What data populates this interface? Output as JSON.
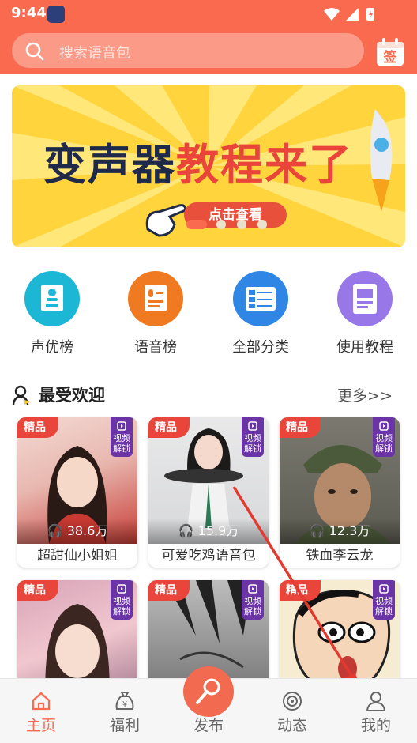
{
  "status": {
    "time": "9:44"
  },
  "search": {
    "placeholder": "搜索语音包"
  },
  "signin": {
    "label": "签"
  },
  "banner": {
    "title_part1": "变声器",
    "title_part2": "教程来了",
    "cta": "点击查看",
    "slide_current": 1,
    "slide_total": 4
  },
  "categories": [
    {
      "label": "声优榜",
      "icon": "voice-actor-icon",
      "color": "#1bb7d4"
    },
    {
      "label": "语音榜",
      "icon": "voice-list-icon",
      "color": "#f07a22"
    },
    {
      "label": "全部分类",
      "icon": "category-list-icon",
      "color": "#2f86e4"
    },
    {
      "label": "使用教程",
      "icon": "book-icon",
      "color": "#9877e8"
    }
  ],
  "section": {
    "title": "最受欢迎",
    "more": "更多>>"
  },
  "cards": [
    {
      "badge": "精品",
      "lock": "视频解锁",
      "plays": "38.6万",
      "name": "超甜仙小姐姐"
    },
    {
      "badge": "精品",
      "lock": "视频解锁",
      "plays": "15.9万",
      "name": "可爱吃鸡语音包"
    },
    {
      "badge": "精品",
      "lock": "视频解锁",
      "plays": "12.3万",
      "name": "铁血李云龙"
    },
    {
      "badge": "精品",
      "lock": "视频解锁",
      "plays": "",
      "name": ""
    },
    {
      "badge": "精品",
      "lock": "视频解锁",
      "plays": "",
      "name": ""
    },
    {
      "badge": "精品",
      "lock": "视频解锁",
      "plays": "",
      "name": ""
    }
  ],
  "tabs": [
    {
      "label": "主页",
      "icon": "home-icon"
    },
    {
      "label": "福利",
      "icon": "money-bag-icon"
    },
    {
      "label": "发布",
      "icon": "microphone-icon"
    },
    {
      "label": "动态",
      "icon": "broadcast-icon"
    },
    {
      "label": "我的",
      "icon": "person-icon"
    }
  ],
  "colors": {
    "accent": "#fa6a4f",
    "badge": "#e9453a",
    "lock": "#6a33a6"
  }
}
